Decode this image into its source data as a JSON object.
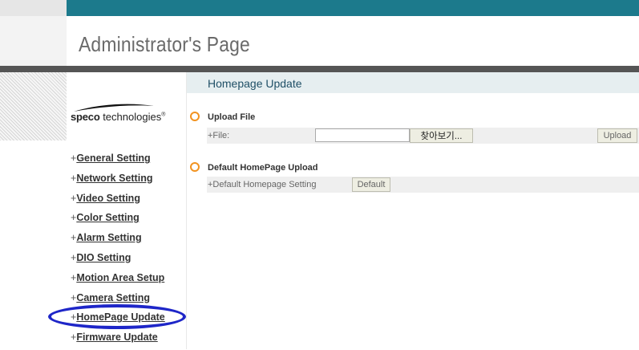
{
  "header": {
    "title": "Administrator's Page"
  },
  "logo": {
    "brand_bold": "speco",
    "brand_rest": " technologies",
    "mark": "®"
  },
  "nav": {
    "items": [
      {
        "prefix": "+",
        "label": "General Setting"
      },
      {
        "prefix": "+",
        "label": "Network Setting"
      },
      {
        "prefix": "+",
        "label": "Video Setting"
      },
      {
        "prefix": "+",
        "label": "Color Setting"
      },
      {
        "prefix": "+",
        "label": "Alarm Setting"
      },
      {
        "prefix": "+",
        "label": "DIO Setting"
      },
      {
        "prefix": "+",
        "label": "Motion Area Setup"
      },
      {
        "prefix": "+",
        "label": "Camera Setting"
      },
      {
        "prefix": "+",
        "label": "HomePage Update"
      },
      {
        "prefix": "+",
        "label": "Firmware Update"
      }
    ],
    "highlighted_index": 8
  },
  "content": {
    "title": "Homepage Update",
    "upload_section": {
      "title": "Upload File",
      "file_label": "+File:",
      "file_value": "",
      "browse_label": "찾아보기...",
      "upload_label": "Upload"
    },
    "default_section": {
      "title": "Default HomePage Upload",
      "setting_label": "+Default Homepage Setting",
      "default_label": "Default"
    }
  },
  "colors": {
    "topbar": "#1c7a8c",
    "divider": "#555555",
    "section_dot": "#f29320",
    "highlight_ring": "#1e26c8",
    "content_title": "#1f4f66"
  }
}
